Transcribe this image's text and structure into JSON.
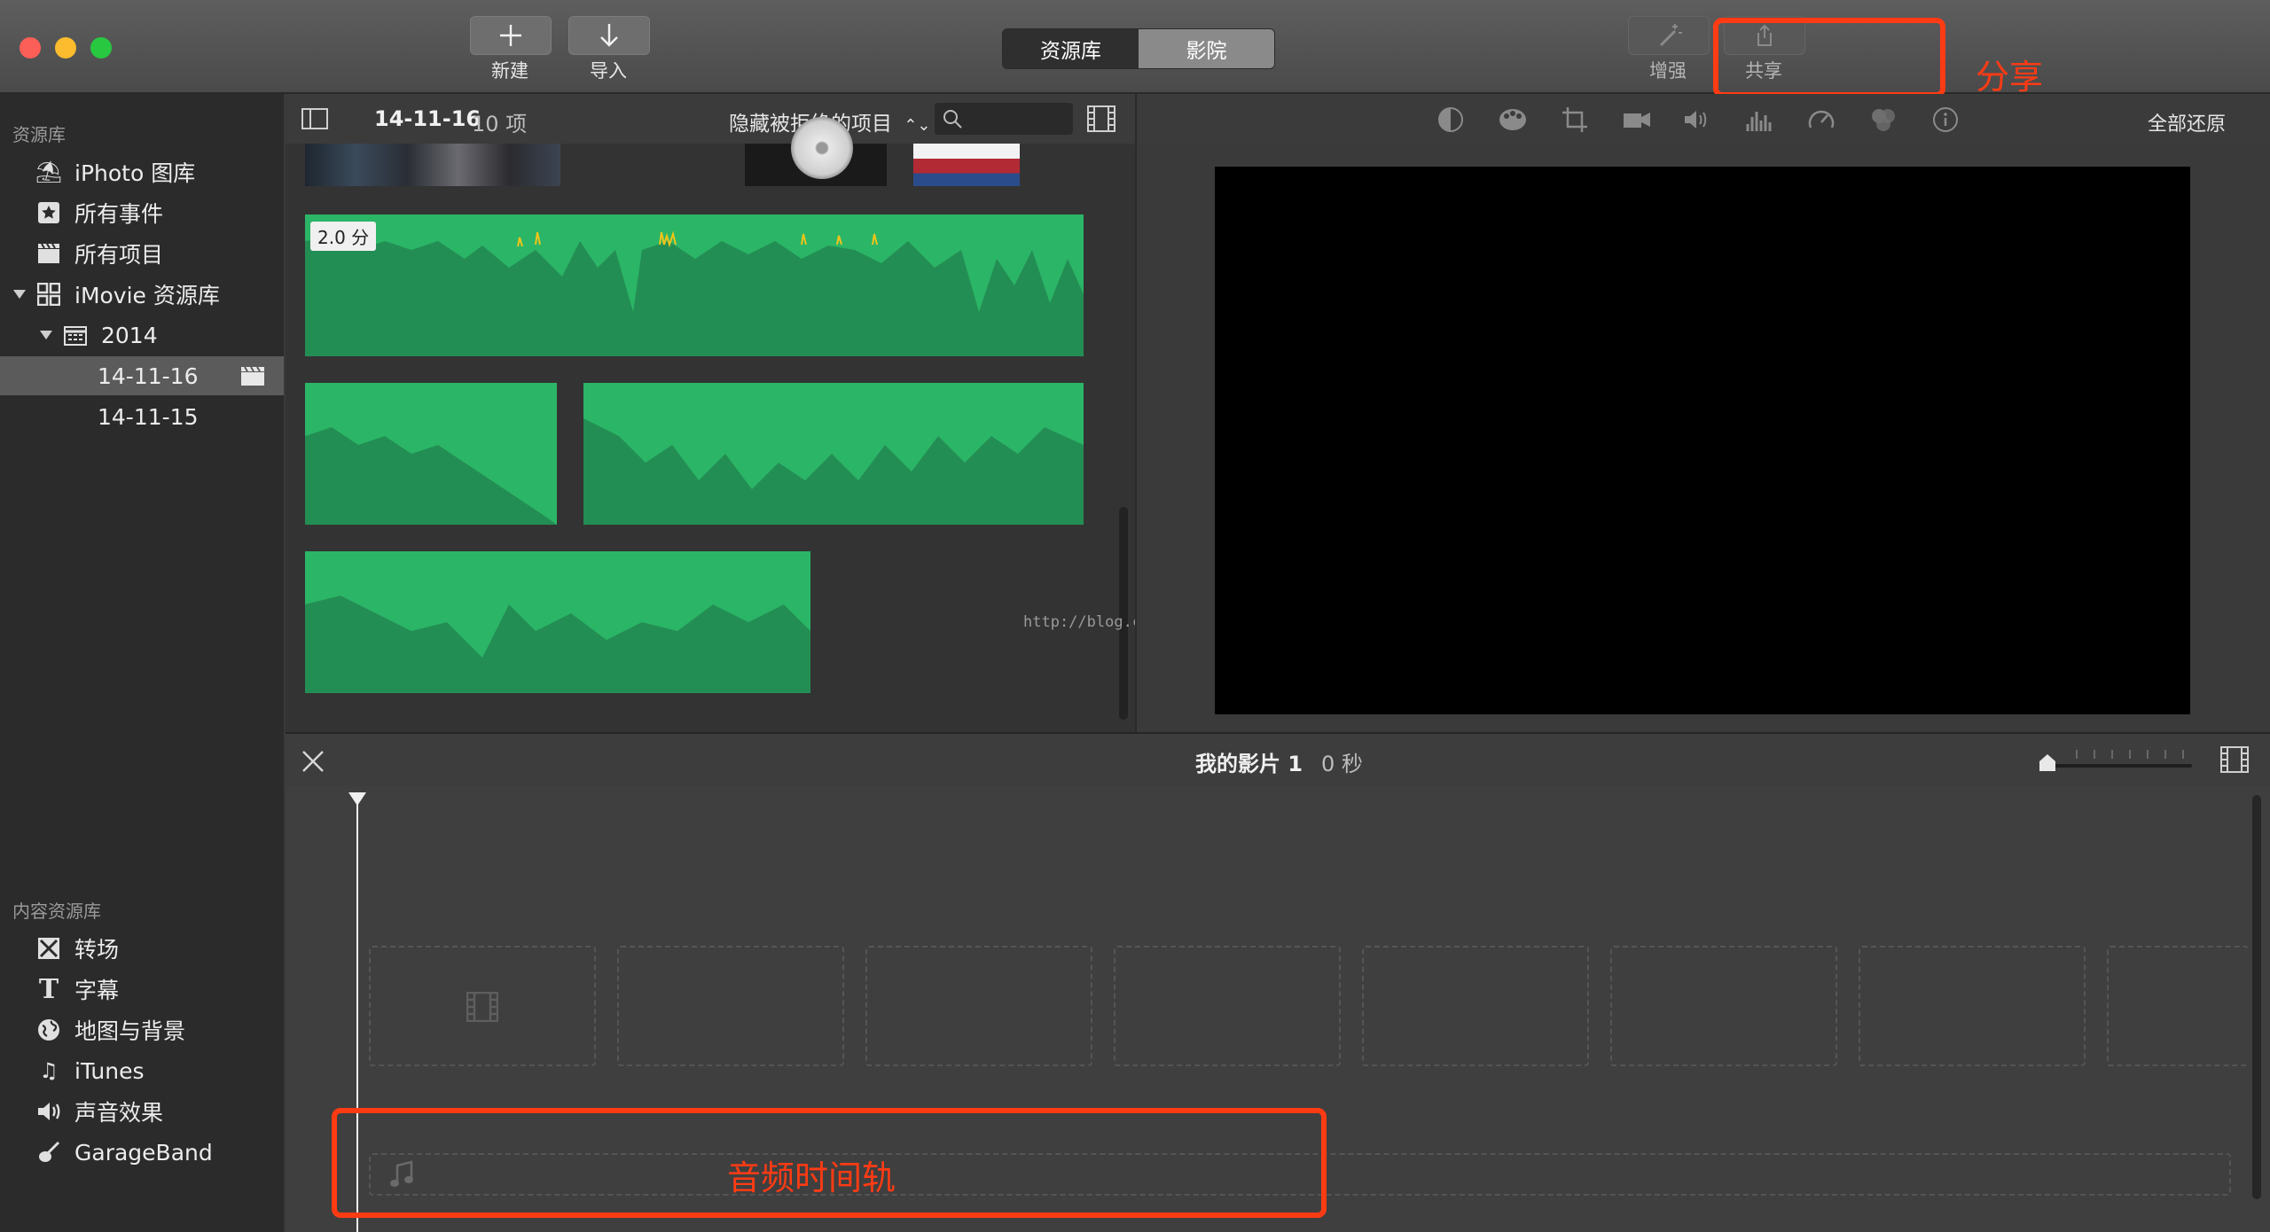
{
  "toolbar": {
    "new_label": "新建",
    "import_label": "导入",
    "segment": [
      "资源库",
      "影院"
    ],
    "enhance_label": "增强",
    "share_label": "共享"
  },
  "annotations": {
    "share": "分享",
    "audio_track": "音频时间轨"
  },
  "sidebar": {
    "library_header": "资源库",
    "items": [
      {
        "label": "iPhoto 图库",
        "icon": "palm-tree-icon"
      },
      {
        "label": "所有事件",
        "icon": "star-icon"
      },
      {
        "label": "所有项目",
        "icon": "clapper-icon"
      },
      {
        "label": "iMovie 资源库",
        "icon": "grid-icon"
      },
      {
        "label": "2014",
        "icon": "calendar-icon"
      },
      {
        "label": "14-11-16",
        "icon": "clapper-icon"
      },
      {
        "label": "14-11-15",
        "icon": ""
      }
    ],
    "content_header": "内容资源库",
    "content_items": [
      {
        "label": "转场",
        "icon": "transition-icon"
      },
      {
        "label": "字幕",
        "icon": "title-t-icon"
      },
      {
        "label": "地图与背景",
        "icon": "globe-icon"
      },
      {
        "label": "iTunes",
        "icon": "music-note-icon"
      },
      {
        "label": "声音效果",
        "icon": "speaker-icon"
      },
      {
        "label": "GarageBand",
        "icon": "guitar-icon"
      }
    ]
  },
  "browser": {
    "event_name": "14-11-16",
    "count": "10 项",
    "filter": "隐藏被拒绝的项目",
    "clip_duration": "2.0 分"
  },
  "viewer": {
    "restore_all": "全部还原"
  },
  "timeline": {
    "project_name": "我的影片 1",
    "duration": "0 秒"
  },
  "watermark": "http://blog.csdn.net/ggtaas",
  "colors": {
    "audio_green": "#2bb567",
    "annotation_red": "#ff3b14"
  }
}
